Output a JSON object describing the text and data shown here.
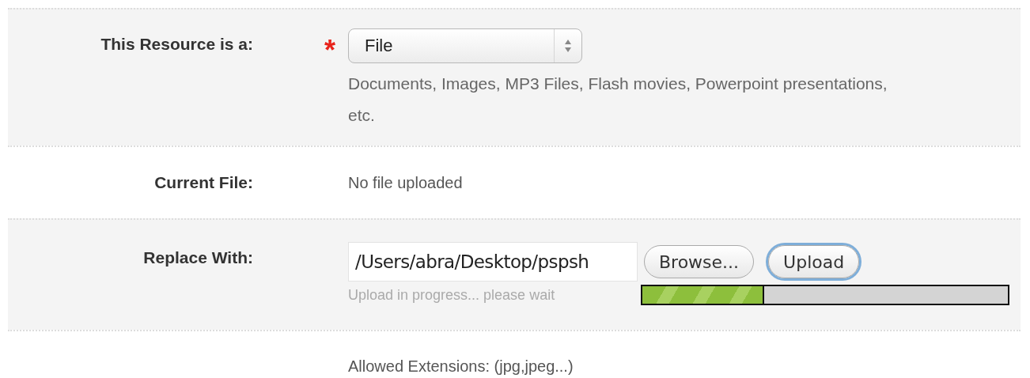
{
  "rows": [
    {
      "kind": "select",
      "label": "This Resource is a:",
      "required_mark": "*",
      "value": "File",
      "hint": "Documents, Images, MP3 Files, Flash movies, Powerpoint presentations, etc."
    },
    {
      "kind": "text",
      "label": "Current File:",
      "text": "No file uploaded"
    },
    {
      "kind": "upload",
      "label": "Replace With:",
      "value": "/Users/abra/Desktop/pspsh",
      "buttons": [
        {
          "label": "Browse...",
          "focused": false
        },
        {
          "label": "Upload",
          "focused": true
        }
      ],
      "status": "Upload in progress... please wait",
      "level": 0.333
    },
    {
      "kind": "note",
      "text": "Allowed Extensions: (jpg,jpeg...)"
    }
  ]
}
